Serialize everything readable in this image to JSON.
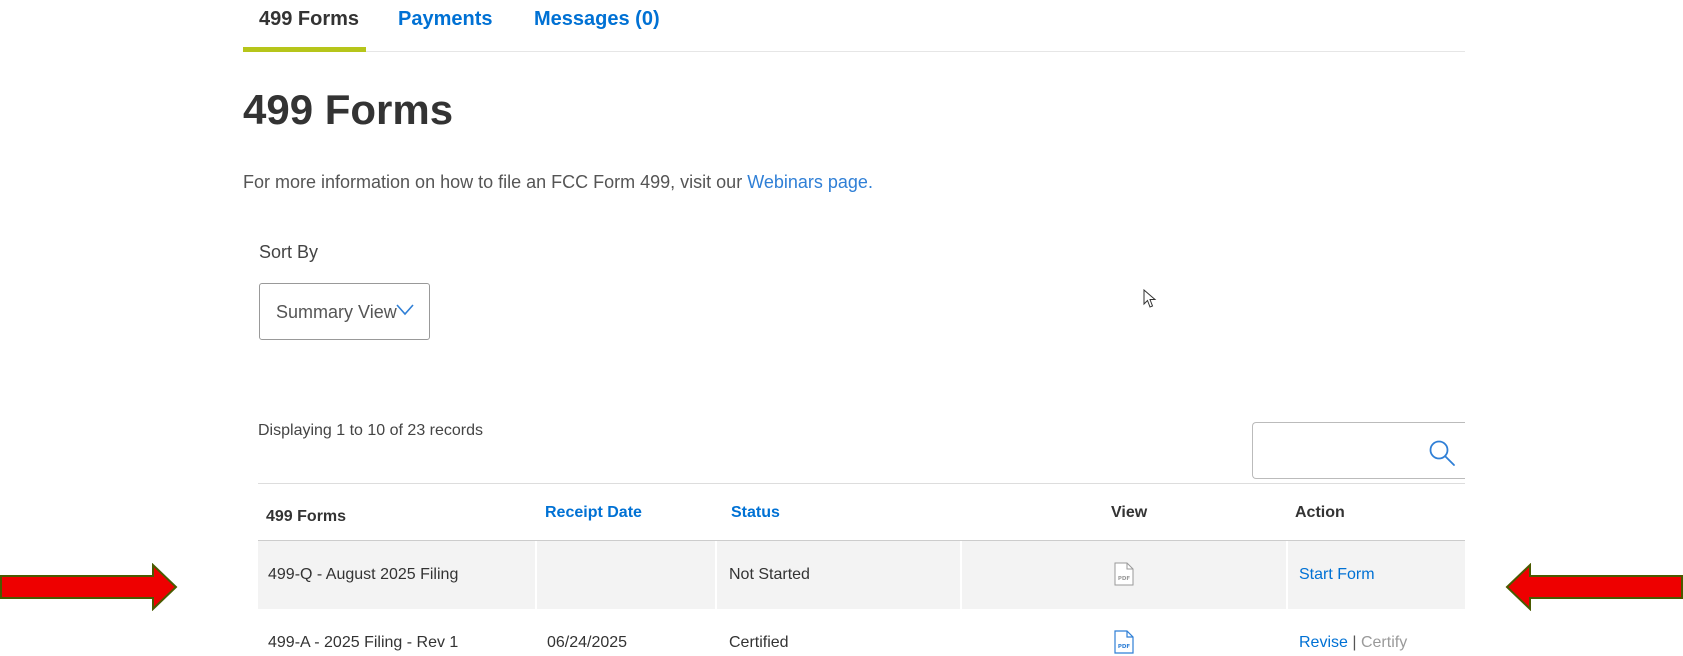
{
  "tabs": [
    {
      "label": "499 Forms",
      "active": true
    },
    {
      "label": "Payments",
      "active": false
    },
    {
      "label": "Messages (0)",
      "active": false
    }
  ],
  "page_title": "499 Forms",
  "info": {
    "text": "For more information on how to file an FCC Form 499, visit our ",
    "link_label": "Webinars page",
    "suffix": "."
  },
  "sort": {
    "label": "Sort By",
    "selected": "Summary View"
  },
  "records_summary": "Displaying 1 to 10 of 23 records",
  "search": {
    "value": "",
    "placeholder": ""
  },
  "table": {
    "headers": {
      "forms": "499 Forms",
      "receipt_date": "Receipt Date",
      "status": "Status",
      "view": "View",
      "action": "Action"
    },
    "rows": [
      {
        "form": "499-Q - August 2025 Filing",
        "receipt_date": "",
        "status": "Not Started",
        "view_icon": "pdf-icon-gray",
        "action_primary": "Start Form",
        "action_sep": "",
        "action_secondary": ""
      },
      {
        "form": "499-A - 2025 Filing - Rev 1",
        "receipt_date": "06/24/2025",
        "status": "Certified",
        "view_icon": "pdf-icon-blue",
        "action_primary": "Revise",
        "action_sep": "|",
        "action_secondary": "Certify"
      }
    ]
  },
  "colors": {
    "accent_underline": "#b6c51a",
    "link": "#0071d4",
    "arrow_fill": "#ee0000",
    "arrow_outline": "#4a5a00"
  }
}
